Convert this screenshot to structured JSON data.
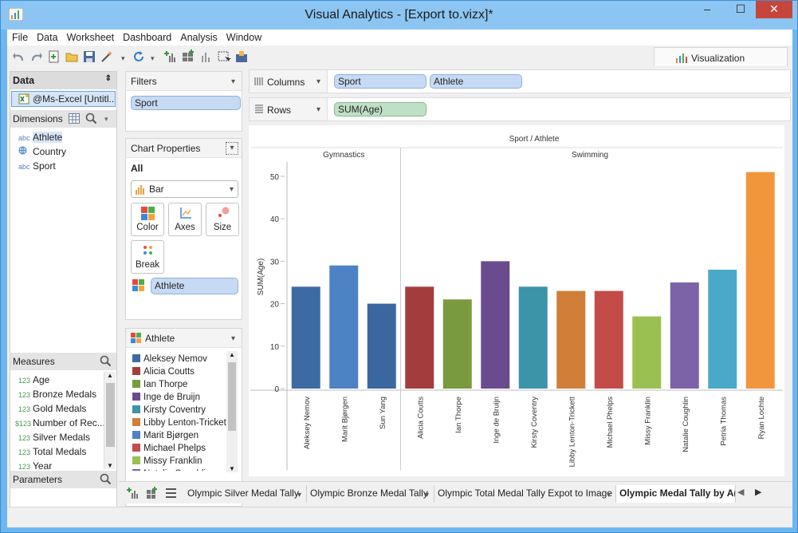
{
  "window": {
    "title": "Visual Analytics - [Export to.vizx]*",
    "minimize": "–",
    "maximize": "☐",
    "close": "✕"
  },
  "menu": [
    "File",
    "Data",
    "Worksheet",
    "Dashboard",
    "Analysis",
    "Window"
  ],
  "visualization_tab": "Visualization",
  "data_panel": {
    "title": "Data",
    "connection": "@Ms-Excel [Untitl...",
    "dimensions_title": "Dimensions",
    "dimensions": [
      {
        "type": "abc",
        "name": "Athlete"
      },
      {
        "type": "globe",
        "name": "Country"
      },
      {
        "type": "abc",
        "name": "Sport"
      }
    ],
    "measures_title": "Measures",
    "measures": [
      {
        "type": "123",
        "name": "Age"
      },
      {
        "type": "123",
        "name": "Bronze Medals"
      },
      {
        "type": "123",
        "name": "Gold Medals"
      },
      {
        "type": "$123",
        "name": "Number of Rec..."
      },
      {
        "type": "123",
        "name": "Silver Medals"
      },
      {
        "type": "123",
        "name": "Total Medals"
      },
      {
        "type": "123",
        "name": "Year"
      }
    ],
    "parameters_title": "Parameters"
  },
  "filters": {
    "title": "Filters",
    "items": [
      "Sport"
    ]
  },
  "chart_properties": {
    "title": "Chart Properties",
    "all_label": "All",
    "chart_type": "Bar",
    "buttons": [
      "Color",
      "Axes",
      "Size",
      "Break"
    ],
    "color_field": "Athlete"
  },
  "legend": {
    "title": "Athlete",
    "items": [
      {
        "name": "Aleksey Nemov",
        "color": "#3c6ba4"
      },
      {
        "name": "Alicia Coutts",
        "color": "#a33d3d"
      },
      {
        "name": "Ian Thorpe",
        "color": "#7a9a3e"
      },
      {
        "name": "Inge de Bruijn",
        "color": "#6a4c8e"
      },
      {
        "name": "Kirsty Coventry",
        "color": "#3b94a8"
      },
      {
        "name": "Libby Lenton-Trickett",
        "color": "#d07e38"
      },
      {
        "name": "Marit Bjørgen",
        "color": "#4d82c4"
      },
      {
        "name": "Michael Phelps",
        "color": "#c44c48"
      },
      {
        "name": "Missy Franklin",
        "color": "#9ac052"
      },
      {
        "name": "Natalie Coughlin",
        "color": "#7c62a8"
      }
    ]
  },
  "shelves": {
    "columns_label": "Columns",
    "columns": [
      "Sport",
      "Athlete"
    ],
    "rows_label": "Rows",
    "rows": [
      "SUM(Age)"
    ]
  },
  "chart_data": {
    "type": "bar",
    "title": "Sport / Athlete",
    "ylabel": "SUM(Age)",
    "ylim": [
      0,
      53
    ],
    "yticks": [
      0,
      10,
      20,
      30,
      40,
      50
    ],
    "groups": [
      {
        "name": "Gymnastics",
        "categories": [
          "Aleksey Nemov",
          "Marit Bjørgen",
          "Sun Yang"
        ],
        "values": [
          24,
          29,
          20
        ],
        "colors": [
          "#3c6ba4",
          "#4d82c4",
          "#3a67a0"
        ]
      },
      {
        "name": "Swimming",
        "categories": [
          "Alicia Coutts",
          "Ian Thorpe",
          "Inge de Bruijn",
          "Kirsty Coventry",
          "Libby Lenton-Trickett",
          "Michael Phelps",
          "Missy Franklin",
          "Natalie Coughlin",
          "Petria Thomas",
          "Ryan Lochte"
        ],
        "values": [
          24,
          21,
          30,
          24,
          23,
          23,
          17,
          25,
          28,
          51
        ],
        "colors": [
          "#a33d3d",
          "#7a9a3e",
          "#6a4c8e",
          "#3b94a8",
          "#d07e38",
          "#c44c48",
          "#9ac052",
          "#7c62a8",
          "#4aa9c8",
          "#f2963e"
        ]
      }
    ],
    "grid": false
  },
  "sheet_tabs": [
    {
      "label": "Olympic Silver Medal Tally",
      "active": false
    },
    {
      "label": "Olympic Bronze Medal Tally",
      "active": false
    },
    {
      "label": "Olympic Total Medal Tally Expot to Image",
      "active": false
    },
    {
      "label": "Olympic Medal Tally by A(",
      "active": true
    }
  ],
  "dropdown_glyph": "▾"
}
